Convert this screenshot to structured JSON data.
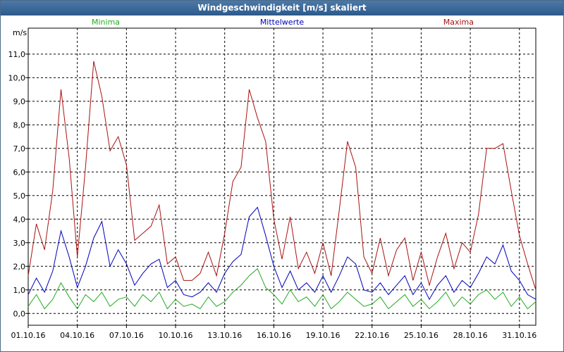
{
  "title": "Windgeschwindigkeit [m/s] skaliert",
  "chart_data": {
    "type": "line",
    "title": "Windgeschwindigkeit [m/s] skaliert",
    "ylabel": "m/s",
    "ylim": [
      -0.5,
      12.1
    ],
    "xlim": [
      0,
      31
    ],
    "yticks": [
      "0,0",
      "1,0",
      "2,0",
      "3,0",
      "4,0",
      "5,0",
      "6,0",
      "7,0",
      "8,0",
      "9,0",
      "10,0",
      "11,0"
    ],
    "xticks": [
      {
        "x": 0,
        "label": "01.10.16"
      },
      {
        "x": 3,
        "label": "04.10.16"
      },
      {
        "x": 6,
        "label": "07.10.16"
      },
      {
        "x": 9,
        "label": "10.10.16"
      },
      {
        "x": 12,
        "label": "13.10.16"
      },
      {
        "x": 15,
        "label": "16.10.16"
      },
      {
        "x": 18,
        "label": "19.10.16"
      },
      {
        "x": 21,
        "label": "22.10.16"
      },
      {
        "x": 24,
        "label": "25.10.16"
      },
      {
        "x": 27,
        "label": "28.10.16"
      },
      {
        "x": 30,
        "label": "31.10.16"
      }
    ],
    "x": [
      0,
      0.5,
      1,
      1.5,
      2,
      2.5,
      3,
      3.5,
      4,
      4.5,
      5,
      5.5,
      6,
      6.5,
      7,
      7.5,
      8,
      8.5,
      9,
      9.5,
      10,
      10.5,
      11,
      11.5,
      12,
      12.5,
      13,
      13.5,
      14,
      14.5,
      15,
      15.5,
      16,
      16.5,
      17,
      17.5,
      18,
      18.5,
      19,
      19.5,
      20,
      20.5,
      21,
      21.5,
      22,
      22.5,
      23,
      23.5,
      24,
      24.5,
      25,
      25.5,
      26,
      26.5,
      27,
      27.5,
      28,
      28.5,
      29,
      29.5,
      30,
      30.5,
      31
    ],
    "grid": true,
    "series": [
      {
        "name": "Minima",
        "color": "#22aa22",
        "values": [
          0.3,
          0.8,
          0.2,
          0.6,
          1.3,
          0.7,
          0.2,
          0.8,
          0.5,
          0.9,
          0.3,
          0.6,
          0.7,
          0.3,
          0.8,
          0.5,
          0.9,
          0.2,
          0.6,
          0.3,
          0.4,
          0.2,
          0.7,
          0.3,
          0.5,
          0.9,
          1.2,
          1.6,
          1.9,
          1.1,
          0.8,
          0.4,
          1.0,
          0.5,
          0.7,
          0.3,
          0.8,
          0.2,
          0.5,
          0.9,
          0.6,
          0.3,
          0.4,
          0.7,
          0.2,
          0.5,
          0.8,
          0.3,
          0.6,
          0.2,
          0.5,
          0.9,
          0.3,
          0.7,
          0.4,
          0.8,
          1.0,
          0.6,
          0.9,
          0.3,
          0.7,
          0.2,
          0.5
        ]
      },
      {
        "name": "Mittelwerte",
        "color": "#0000bb",
        "values": [
          0.8,
          1.5,
          0.9,
          1.8,
          3.5,
          2.4,
          1.1,
          2.0,
          3.2,
          3.9,
          2.0,
          2.7,
          2.1,
          1.2,
          1.7,
          2.1,
          2.3,
          1.1,
          1.4,
          0.8,
          0.7,
          0.9,
          1.3,
          0.9,
          1.7,
          2.2,
          2.5,
          4.1,
          4.5,
          3.3,
          2.0,
          1.1,
          1.8,
          1.0,
          1.3,
          0.9,
          1.6,
          0.9,
          1.6,
          2.4,
          2.1,
          1.0,
          0.9,
          1.3,
          0.8,
          1.2,
          1.6,
          0.8,
          1.3,
          0.6,
          1.2,
          1.6,
          0.9,
          1.4,
          1.1,
          1.7,
          2.4,
          2.1,
          2.9,
          1.8,
          1.4,
          0.8,
          0.6
        ]
      },
      {
        "name": "Maxima",
        "color": "#aa1111",
        "values": [
          1.6,
          3.8,
          2.7,
          5.2,
          9.5,
          6.6,
          2.4,
          6.2,
          10.7,
          9.2,
          6.9,
          7.5,
          6.3,
          3.1,
          3.4,
          3.7,
          4.6,
          2.1,
          2.4,
          1.4,
          1.4,
          1.7,
          2.6,
          1.6,
          3.4,
          5.6,
          6.2,
          9.5,
          8.3,
          7.3,
          4.0,
          2.3,
          4.1,
          1.9,
          2.6,
          1.7,
          3.0,
          1.6,
          4.4,
          7.3,
          6.2,
          2.4,
          1.7,
          3.2,
          1.6,
          2.7,
          3.2,
          1.4,
          2.6,
          1.2,
          2.4,
          3.4,
          1.9,
          3.0,
          2.6,
          4.2,
          7.0,
          7.0,
          7.2,
          5.2,
          3.3,
          2.1,
          1.0
        ]
      }
    ]
  }
}
